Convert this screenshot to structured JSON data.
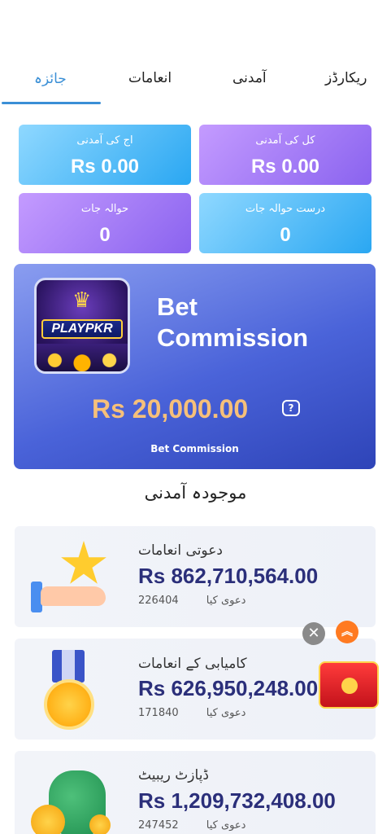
{
  "tabs": [
    {
      "label": "جائزہ",
      "active": true
    },
    {
      "label": "انعامات",
      "active": false
    },
    {
      "label": "آمدنی",
      "active": false
    },
    {
      "label": "ریکارڈز",
      "active": false
    }
  ],
  "stats": {
    "today_income": {
      "label": "اج کی آمدنی",
      "value": "Rs 0.00"
    },
    "yesterday_income": {
      "label": "کل کی آمدنی",
      "value": "Rs 0.00"
    },
    "referrals": {
      "label": "حوالہ جات",
      "value": "0"
    },
    "valid_referrals": {
      "label": "درست حوالہ جات",
      "value": "0"
    }
  },
  "commission": {
    "logo_text": "PLAYPKR",
    "title_line1": "Bet",
    "title_line2": "Commission",
    "amount": "Rs 20,000.00",
    "help_glyph": "?",
    "footer": "Bet Commission"
  },
  "section_title": "موجودہ آمدنی",
  "rewards": [
    {
      "label": "دعوتی انعامات",
      "amount": "Rs 862,710,564.00",
      "claimed_label": "دعوی کیا",
      "claimed_count": "226404"
    },
    {
      "label": "کامیابی کے انعامات",
      "amount": "Rs 626,950,248.00",
      "claimed_label": "دعوی کیا",
      "claimed_count": "171840"
    },
    {
      "label": "ڈپازٹ ریبیٹ",
      "amount": "Rs 1,209,732,408.00",
      "claimed_label": "دعوی کیا",
      "claimed_count": "247452"
    }
  ],
  "floating": {
    "close_glyph": "✕",
    "up_glyph": "︽"
  },
  "colors": {
    "accent": "#3a8fd6",
    "amount": "#2b2f7a",
    "commission_amount": "#f6c07a"
  }
}
